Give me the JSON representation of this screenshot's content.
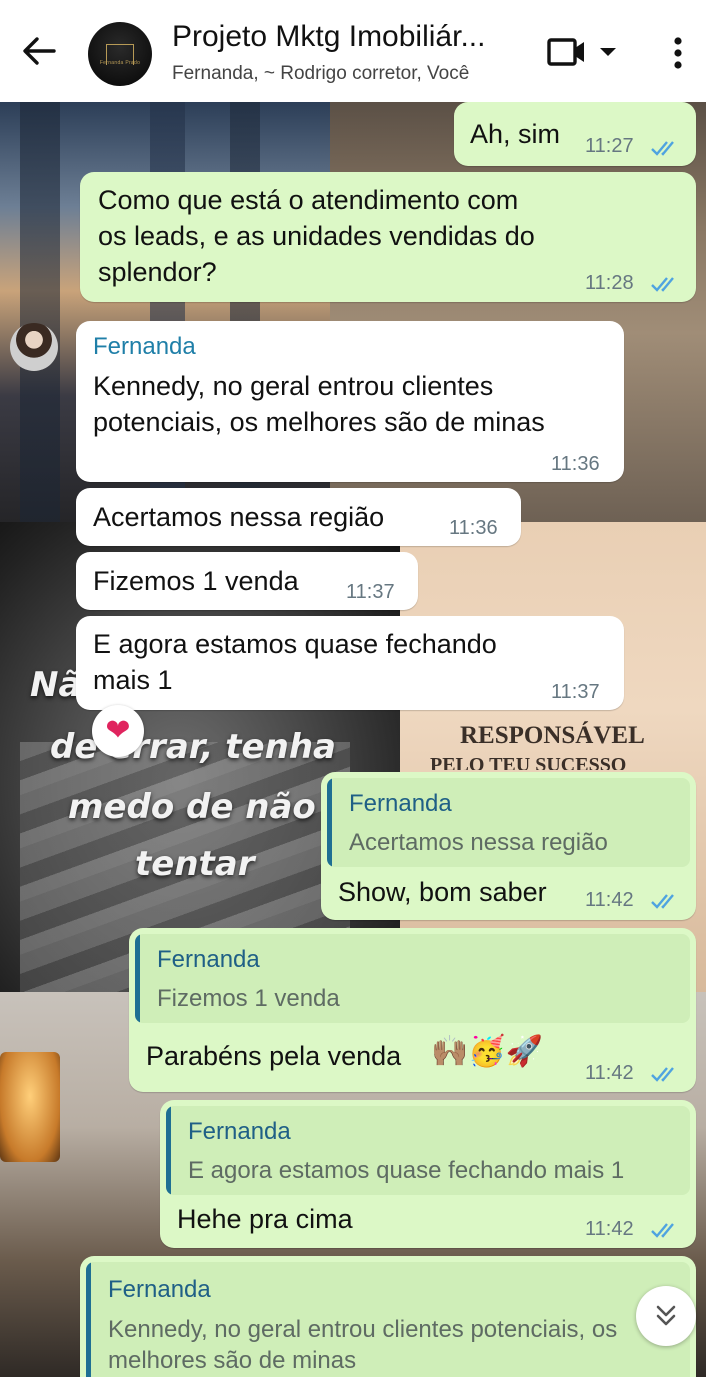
{
  "header": {
    "title": "Projeto Mktg Imobiliár...",
    "subtitle": "Fernanda, ~ Rodrigo corretor, Você",
    "avatar_text": "Fernanda Prado"
  },
  "wallpaper": {
    "quote_line_1": "Nã",
    "quote_line_2": "de errar, tenha",
    "quote_line_3": "medo de não",
    "quote_line_4": "tentar",
    "banner_1": "RESPONSÁVEL",
    "banner_2": "PELO TEU SUCESSO"
  },
  "messages": [
    {
      "text": "Ah, sim",
      "time": "11:27"
    },
    {
      "text": "Como que está o atendimento com\nos leads, e as unidades vendidas do\nsplendor?",
      "time": "11:28"
    },
    {
      "sender": "Fernanda",
      "text": "Kennedy, no geral entrou clientes\npotenciais, os melhores são de minas",
      "time": "11:36"
    },
    {
      "text": "Acertamos nessa região",
      "time": "11:36"
    },
    {
      "text": "Fizemos 1 venda",
      "time": "11:37"
    },
    {
      "text": "E agora estamos quase fechando\nmais 1",
      "time": "11:37",
      "reaction": "❤"
    },
    {
      "quote_name": "Fernanda",
      "quote_text": "Acertamos nessa região",
      "text": "Show, bom saber",
      "time": "11:42"
    },
    {
      "quote_name": "Fernanda",
      "quote_text": "Fizemos 1 venda",
      "text": "Parabéns pela venda",
      "emojis": "🙌🏽🥳🚀",
      "time": "11:42"
    },
    {
      "quote_name": "Fernanda",
      "quote_text": "E agora estamos quase fechando mais 1",
      "text": "Hehe pra cima",
      "time": "11:42"
    },
    {
      "quote_name": "Fernanda",
      "quote_text": "Kennedy, no geral entrou clientes potenciais, os\nmelhores são de minas"
    }
  ],
  "colors": {
    "outgoing_bubble": "#dcf8c6",
    "incoming_bubble": "#ffffff",
    "read_ticks": "#4fa3e0",
    "sender_name": "#1f7fa8"
  }
}
